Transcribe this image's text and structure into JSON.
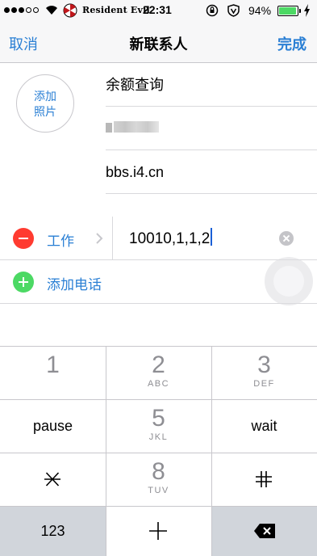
{
  "status_bar": {
    "carrier": "Resident Evil",
    "time": "22:31",
    "battery_percent": "94%",
    "battery_level": 0.94,
    "signal_bars_filled": 3,
    "signal_bars_total": 5
  },
  "nav": {
    "cancel_label": "取消",
    "title": "新联系人",
    "done_label": "完成",
    "accent_color": "#2a7fd4"
  },
  "photo": {
    "label_line1": "添加",
    "label_line2": "照片"
  },
  "fields": {
    "first_name": "余额查询",
    "company": "bbs.i4.cn"
  },
  "phone": {
    "label": "工作",
    "value": "10010,1,1,2"
  },
  "add_phone_label": "添加电话",
  "keypad": {
    "k1": "1",
    "k2": "2",
    "k2_letters": "ABC",
    "k3": "3",
    "k3_letters": "DEF",
    "pause": "pause",
    "k5": "5",
    "k5_letters": "JKL",
    "wait": "wait",
    "k8": "8",
    "k8_letters": "TUV",
    "k123": "123"
  }
}
